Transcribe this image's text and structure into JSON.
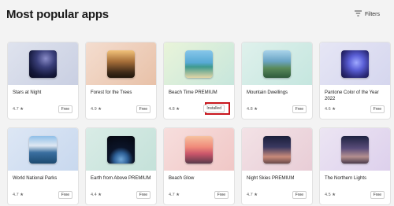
{
  "page": {
    "title": "Most popular apps"
  },
  "filters": {
    "label": "Filters",
    "icon": "filter-lines-icon"
  },
  "accent": "#c8161d",
  "apps": [
    {
      "name": "Stars at Night",
      "rating": "4.7 ★",
      "price": "Free",
      "bg": "linear-gradient(135deg,#dfe3ee,#c9cfe2)",
      "thumb": "radial-gradient(circle at 60% 30%,#8a8cc8 0%,#3a3f7a 35%,#14183a 70%,#0a0c1e 100%)"
    },
    {
      "name": "Forest for the Trees",
      "rating": "4.9 ★",
      "price": "Free",
      "bg": "linear-gradient(135deg,#f4ddcf,#e8c1a8)",
      "thumb": "linear-gradient(180deg,#f1c27a 0%,#a8703a 40%,#3e2a18 80%,#20150c 100%)"
    },
    {
      "name": "Beach Time PREMIUM",
      "rating": "4.8 ★",
      "price": "Installed",
      "bg": "linear-gradient(135deg,#e9f4d9,#c7e6dc)",
      "thumb": "linear-gradient(180deg,#87c7ea 0%,#57a9d4 45%,#3f9a8e 60%,#e4d6a6 100%)"
    },
    {
      "name": "Mountain Dwellings",
      "rating": "4.8 ★",
      "price": "Free",
      "bg": "linear-gradient(135deg,#dff1ec,#c5e6df)",
      "thumb": "linear-gradient(180deg,#a9d3ea 0%,#6aa4c4 40%,#5a8a5a 65%,#2e5a3c 100%)"
    },
    {
      "name": "Pantone Color of the Year 2022",
      "rating": "4.6 ★",
      "price": "Free",
      "bg": "linear-gradient(135deg,#e6e6f5,#d5d6ee)",
      "thumb": "radial-gradient(circle at 55% 45%,#9ea8ff 0%,#5a5fd6 35%,#2c2b7a 70%,#14123e 100%)"
    },
    {
      "name": "World National Parks",
      "rating": "4.7 ★",
      "price": "Free",
      "bg": "linear-gradient(135deg,#dde7f5,#c8d8ee)",
      "thumb": "linear-gradient(180deg,#8fbfe8 0%,#dfe8f2 35%,#3a6fa0 60%,#1d4a70 100%)"
    },
    {
      "name": "Earth from Above PREMIUM",
      "rating": "4.4 ★",
      "price": "Free",
      "bg": "linear-gradient(135deg,#d9ece6,#c4e1d9)",
      "thumb": "radial-gradient(circle at 50% 85%,#6fa7d8 0%,#2d5f96 25%,#0b1428 45%,#05070f 100%)"
    },
    {
      "name": "Beach Glow",
      "rating": "4.7 ★",
      "price": "Free",
      "bg": "linear-gradient(135deg,#f7dedd,#f0c7c6)",
      "thumb": "linear-gradient(180deg,#f6c3a0 0%,#f08a7a 40%,#c9556a 65%,#5a3a4a 100%)"
    },
    {
      "name": "Night Skies PREMIUM",
      "rating": "4.7 ★",
      "price": "Free",
      "bg": "linear-gradient(135deg,#f3e2e6,#e8cdd6)",
      "thumb": "linear-gradient(180deg,#1a1f3a 0%,#3a3860 40%,#c98a7a 75%,#6a4a4a 100%)"
    },
    {
      "name": "The Northern Lights",
      "rating": "4.5 ★",
      "price": "Free",
      "bg": "linear-gradient(135deg,#ece5f3,#ddd0ec)",
      "thumb": "linear-gradient(180deg,#1d2240 0%,#5a4d7a 45%,#b48f8f 75%,#4a3a4a 100%)"
    }
  ]
}
